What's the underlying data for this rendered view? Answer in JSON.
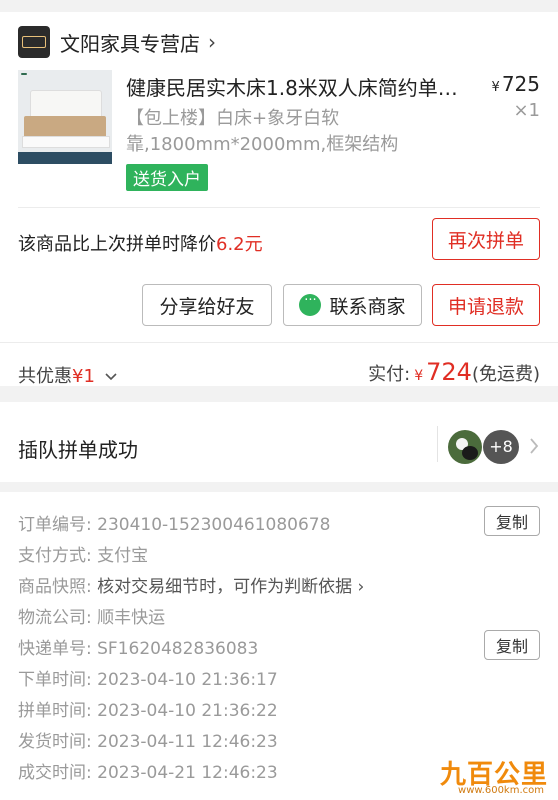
{
  "store": {
    "name": "文阳家具专营店",
    "arrow": "›"
  },
  "product": {
    "title": "健康民居实木床1.8米双人床简约单…",
    "spec": "【包上楼】白床+象牙白软靠,1800mm*2000mm,框架结构",
    "badge": "送货入户",
    "price_currency": "¥",
    "price": "725",
    "quantity": "×1"
  },
  "price_drop": {
    "prefix": "该商品比上次拼单时降价",
    "amount": "6.2元"
  },
  "actions": {
    "rebuy": "再次拼单",
    "share": "分享给好友",
    "contact": "联系商家",
    "refund": "申请退款"
  },
  "summary": {
    "discount_label": "共优惠",
    "discount_value": "¥1",
    "paid_label": "实付:",
    "paid_currency": "¥",
    "paid_amount": "724",
    "shipping_note": "(免运费)"
  },
  "group": {
    "title": "插队拼单成功",
    "extra_count": "+8"
  },
  "order_info": [
    {
      "label": "订单编号:",
      "value": "230410-152300461080678",
      "copy": true
    },
    {
      "label": "支付方式:",
      "value": "支付宝"
    },
    {
      "label": "商品快照:",
      "value": "核对交易细节时，可作为判断依据 ›"
    },
    {
      "label": "物流公司:",
      "value": "顺丰快运"
    },
    {
      "label": "快递单号:",
      "value": "SF1620482836083",
      "copy": true
    },
    {
      "label": "下单时间:",
      "value": "2023-04-10 21:36:17"
    },
    {
      "label": "拼单时间:",
      "value": "2023-04-10 21:36:22"
    },
    {
      "label": "发货时间:",
      "value": "2023-04-11 12:46:23"
    },
    {
      "label": "成交时间:",
      "value": "2023-04-21 12:46:23"
    }
  ],
  "copy_label": "复制",
  "watermark": {
    "text": "九百公里",
    "url": "www.600km.com"
  }
}
